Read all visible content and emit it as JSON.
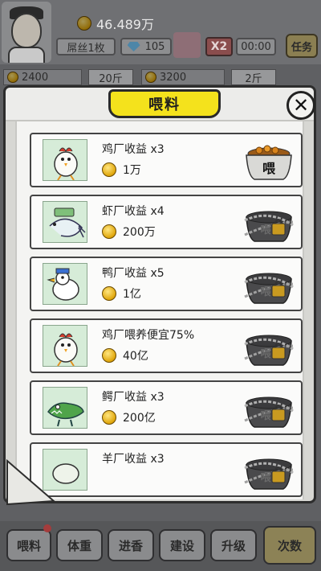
{
  "hud": {
    "coins": "46.489万",
    "rank_label": "屌丝1枚",
    "gems": "105",
    "multiplier": "X2",
    "timer": "00:00",
    "task_label": "任务",
    "stats": [
      {
        "value": "2400",
        "unit": "20斤"
      },
      {
        "value": "3200",
        "unit": "2斤"
      }
    ]
  },
  "modal": {
    "title": "喂料",
    "close_label": "✕",
    "items": [
      {
        "name": "鸡厂收益 x3",
        "cost": "1万",
        "thumb": "chicken",
        "locked": false
      },
      {
        "name": "虾厂收益 x4",
        "cost": "200万",
        "thumb": "shrimp",
        "locked": true
      },
      {
        "name": "鸭厂收益 x5",
        "cost": "1亿",
        "thumb": "duck",
        "locked": true
      },
      {
        "name": "鸡厂喂养便宜75%",
        "cost": "40亿",
        "thumb": "chicken",
        "locked": true
      },
      {
        "name": "鳄厂收益 x3",
        "cost": "200亿",
        "thumb": "crocodile",
        "locked": true
      },
      {
        "name": "羊厂收益 x3",
        "cost": "",
        "thumb": "sheep",
        "locked": true
      }
    ],
    "feed_bowl_label": "喂"
  },
  "bottom_nav": [
    {
      "label": "喂料",
      "active": false
    },
    {
      "label": "体重",
      "active": false
    },
    {
      "label": "进香",
      "active": false
    },
    {
      "label": "建设",
      "active": false
    },
    {
      "label": "升级",
      "active": false
    },
    {
      "label": "次数",
      "active": true
    }
  ],
  "colors": {
    "title_plaque": "#f4e21c",
    "coin": "#e0a60a",
    "card_border": "#444444"
  }
}
